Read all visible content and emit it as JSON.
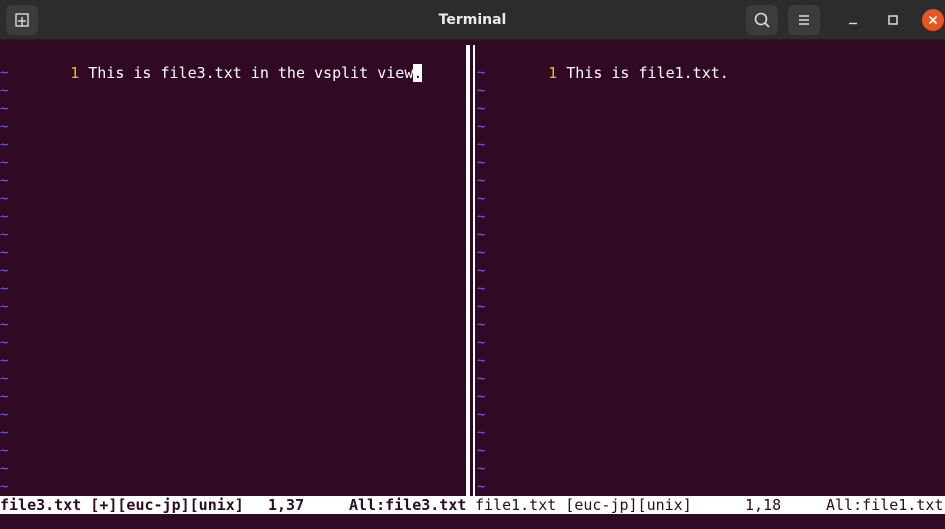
{
  "window": {
    "title": "Terminal",
    "icons": {
      "new_tab": "new-tab-icon",
      "search": "search-icon",
      "menu": "hamburger-menu-icon",
      "minimize": "minimize-icon",
      "maximize": "maximize-icon",
      "close": "close-icon"
    },
    "colors": {
      "background": "#300a24",
      "titlebar": "#2c2c2c",
      "close_button": "#e95420",
      "line_number": "#e5c400",
      "tilde": "#6b6bd6"
    }
  },
  "left_pane": {
    "line_number": "1",
    "text_before_cursor": "This is file3.txt in the vsplit view",
    "cursor_char": ".",
    "tilde": "~",
    "tilde_count": 24,
    "status": {
      "file": "file3.txt [+][euc-jp][unix]",
      "position": "1,37",
      "scroll": "All:file3.txt"
    }
  },
  "right_pane": {
    "line_number": "1",
    "text": "This is file1.txt.",
    "tilde": "~",
    "tilde_count": 24,
    "status": {
      "file": "file1.txt [euc-jp][unix]",
      "position": "1,18",
      "scroll": "All:file1.txt"
    }
  }
}
